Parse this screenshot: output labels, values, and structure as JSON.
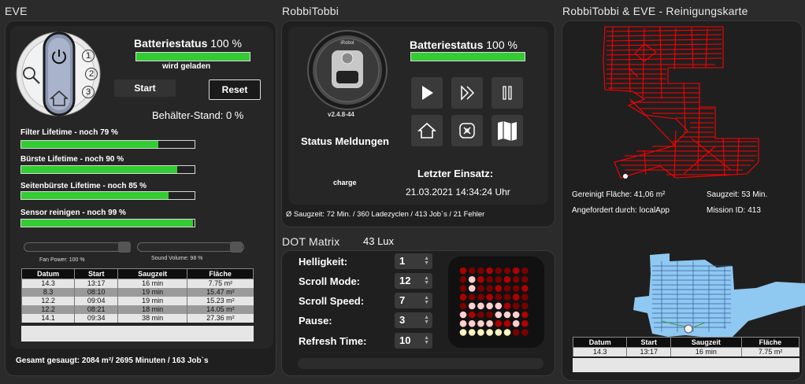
{
  "eve": {
    "title": "EVE",
    "remote": {
      "keys": [
        "1",
        "2",
        "3"
      ]
    },
    "battery_label": "Batteriestatus",
    "battery_value": "100 %",
    "battery_level": 1.0,
    "charge_status": "wird geladen",
    "start_label": "Start",
    "reset_label": "Reset",
    "bin_level": "Behälter-Stand: 0 %",
    "lifetimes": [
      {
        "label": "Filter Lifetime - noch 79 %",
        "level": 0.79
      },
      {
        "label": "Bürste Lifetime - noch 90 %",
        "level": 0.9
      },
      {
        "label": "Seitenbürste Lifetime - noch 85 %",
        "level": 0.85
      },
      {
        "label": "Sensor reinigen - noch 99 %",
        "level": 0.99
      }
    ],
    "fan_label": "Fan Power: 100 %",
    "fan_level": 1.0,
    "volume_label": "Sound Volume: 98 %",
    "volume_level": 0.98,
    "table_headers": [
      "Datum",
      "Start",
      "Saugzeit",
      "Fläche"
    ],
    "table_rows": [
      [
        "14.3",
        "13:17",
        "16 min",
        "7.75 m²"
      ],
      [
        "8.3",
        "08:10",
        "19 min",
        "15.47 m²"
      ],
      [
        "12.2",
        "09:04",
        "19 min",
        "15.23 m²"
      ],
      [
        "12.2",
        "08:21",
        "18 min",
        "14.05 m²"
      ],
      [
        "14.1",
        "09:34",
        "38 min",
        "27.36 m²"
      ]
    ],
    "total": "Gesamt gesaugt: 2084 m²/ 2695 Minuten / 163 Job`s"
  },
  "robbi": {
    "title": "RobbiTobbi",
    "version": "v2.4.8-44",
    "battery_label": "Batteriestatus",
    "battery_value": "100 %",
    "battery_level": 1.0,
    "status_title": "Status Meldungen",
    "status_value": "charge",
    "last_run_label": "Letzter Einsatz:",
    "last_run_value": "21.03.2021 14:34:24 Uhr",
    "stats": "Ø Saugzeit: 72 Min. / 360 Ladezyclen  / 413 Job`s  / 21 Fehler",
    "controls": [
      "play-icon",
      "resume-icon",
      "pause-icon",
      "home-icon",
      "locate-icon",
      "map-icon"
    ]
  },
  "dot": {
    "title": "DOT Matrix",
    "lux": "43 Lux",
    "settings": [
      {
        "label": "Helligkeit:",
        "value": "1"
      },
      {
        "label": "Scroll Mode:",
        "value": "12"
      },
      {
        "label": "Scroll Speed:",
        "value": "7"
      },
      {
        "label": "Pause:",
        "value": "3"
      },
      {
        "label": "Refresh Time:",
        "value": "10"
      }
    ]
  },
  "map": {
    "title": "RobbiTobbi & EVE - Reinigungskarte",
    "cleaned": "Gereinigt Fläche: 41,06 m²",
    "duration": "Saugzeit: 53 Min.",
    "requested": "Angefordert durch: localApp",
    "mission": "Mission ID: 413",
    "table_headers": [
      "Datum",
      "Start",
      "Saugzeit",
      "Fläche"
    ],
    "table_rows": [
      [
        "14.3",
        "13:17",
        "16 min",
        "7.75 m²"
      ]
    ]
  },
  "colors": {
    "accent_green": "#33cc33",
    "map_red": "#ff0000",
    "map_blue": "#8fc8f0",
    "led_on": "#ff3030"
  }
}
